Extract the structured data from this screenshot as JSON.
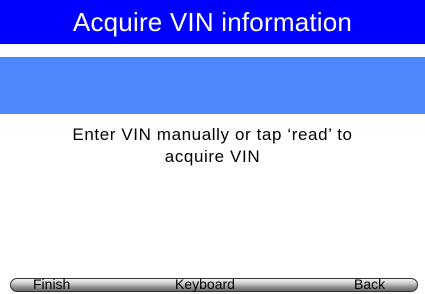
{
  "header": {
    "title": "Acquire VIN information"
  },
  "vin_input": {
    "value": "",
    "placeholder": ""
  },
  "instructions": {
    "line1": "Enter VIN manually or tap ‘read’ to",
    "line2": "acquire VIN"
  },
  "toolbar": {
    "finish_label": "Finish",
    "keyboard_label": "Keyboard",
    "back_label": "Back"
  },
  "colors": {
    "title_bar_bg": "#0000ff",
    "input_bg": "#4d88ff",
    "text": "#000000"
  }
}
